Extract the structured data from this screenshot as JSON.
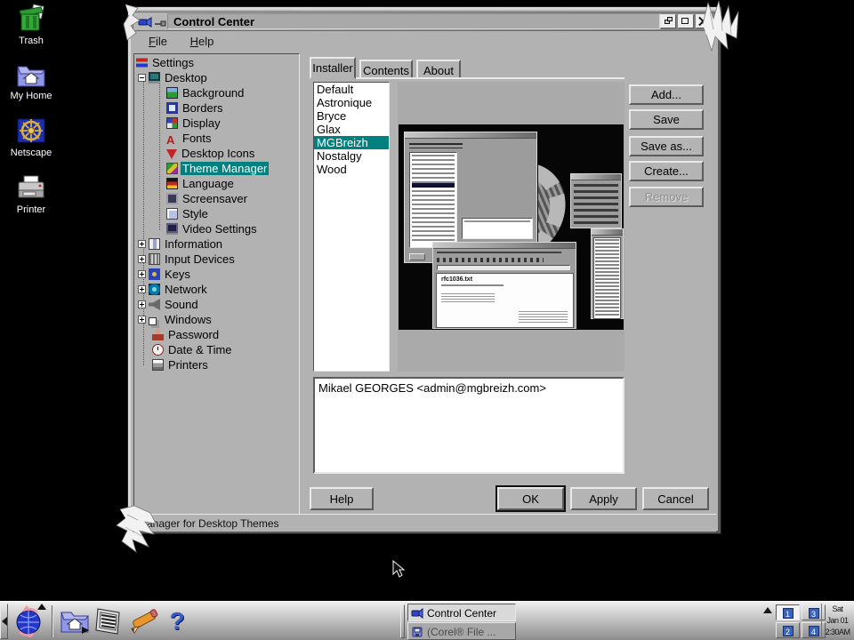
{
  "colors": {
    "selection": "#00807f",
    "desktop_bg": "#000000",
    "window_bg": "#b2b2b2"
  },
  "desktop_icons": [
    {
      "label": "Trash"
    },
    {
      "label": "My Home"
    },
    {
      "label": "Netscape"
    },
    {
      "label": "Printer"
    }
  ],
  "window": {
    "title": "Control Center",
    "menu": [
      {
        "label": "File"
      },
      {
        "label": "Help"
      }
    ],
    "tree": {
      "selected": "Theme Manager",
      "items": [
        {
          "label": "Settings",
          "level": 0
        },
        {
          "label": "Desktop",
          "level": 1,
          "expanded": true
        },
        {
          "label": "Background",
          "level": 2
        },
        {
          "label": "Borders",
          "level": 2
        },
        {
          "label": "Display",
          "level": 2
        },
        {
          "label": "Fonts",
          "level": 2
        },
        {
          "label": "Desktop Icons",
          "level": 2
        },
        {
          "label": "Theme Manager",
          "level": 2,
          "selected": true
        },
        {
          "label": "Language",
          "level": 2
        },
        {
          "label": "Screensaver",
          "level": 2
        },
        {
          "label": "Style",
          "level": 2
        },
        {
          "label": "Video Settings",
          "level": 2
        },
        {
          "label": "Information",
          "level": 1,
          "expanded": false
        },
        {
          "label": "Input Devices",
          "level": 1,
          "expanded": false
        },
        {
          "label": "Keys",
          "level": 1,
          "expanded": false
        },
        {
          "label": "Network",
          "level": 1,
          "expanded": false
        },
        {
          "label": "Sound",
          "level": 1,
          "expanded": false
        },
        {
          "label": "Windows",
          "level": 1,
          "expanded": false
        },
        {
          "label": "Password",
          "level": 1
        },
        {
          "label": "Date & Time",
          "level": 1
        },
        {
          "label": "Printers",
          "level": 1
        }
      ]
    },
    "tabs": [
      {
        "label": "Installer",
        "active": true
      },
      {
        "label": "Contents",
        "active": false
      },
      {
        "label": "About",
        "active": false
      }
    ],
    "theme_list": {
      "items": [
        "Default",
        "Astronique",
        "Bryce",
        "Glax",
        "MGBreizh",
        "Nostalgy",
        "Wood"
      ],
      "selected": "MGBreizh",
      "selected_index": 4
    },
    "side_buttons": [
      {
        "label": "Add...",
        "disabled": false
      },
      {
        "label": "Save",
        "disabled": false
      },
      {
        "label": "Save as...",
        "disabled": false
      },
      {
        "label": "Create...",
        "disabled": false
      },
      {
        "label": "Remove",
        "disabled": true
      }
    ],
    "preview": {
      "filename": "rfc1036.txt"
    },
    "author_field": "Mikael GEORGES <admin@mgbreizh.com>",
    "dialog_buttons": [
      {
        "label": "Help",
        "default": false
      },
      {
        "label": "OK",
        "default": true
      },
      {
        "label": "Apply",
        "default": false
      },
      {
        "label": "Cancel",
        "default": false
      }
    ],
    "status_bar": "Manager for Desktop Themes"
  },
  "taskbar": {
    "icons": {
      "help": "?"
    },
    "tasks": [
      {
        "label": "Control Center",
        "active": true
      },
      {
        "label": "(Corel® File ...",
        "active": false
      }
    ],
    "pager": [
      "1",
      "3",
      "2",
      "4"
    ],
    "pager_active": "1",
    "clock": {
      "day": "Sat",
      "date": "Jan 01",
      "time": "2:30AM"
    }
  }
}
